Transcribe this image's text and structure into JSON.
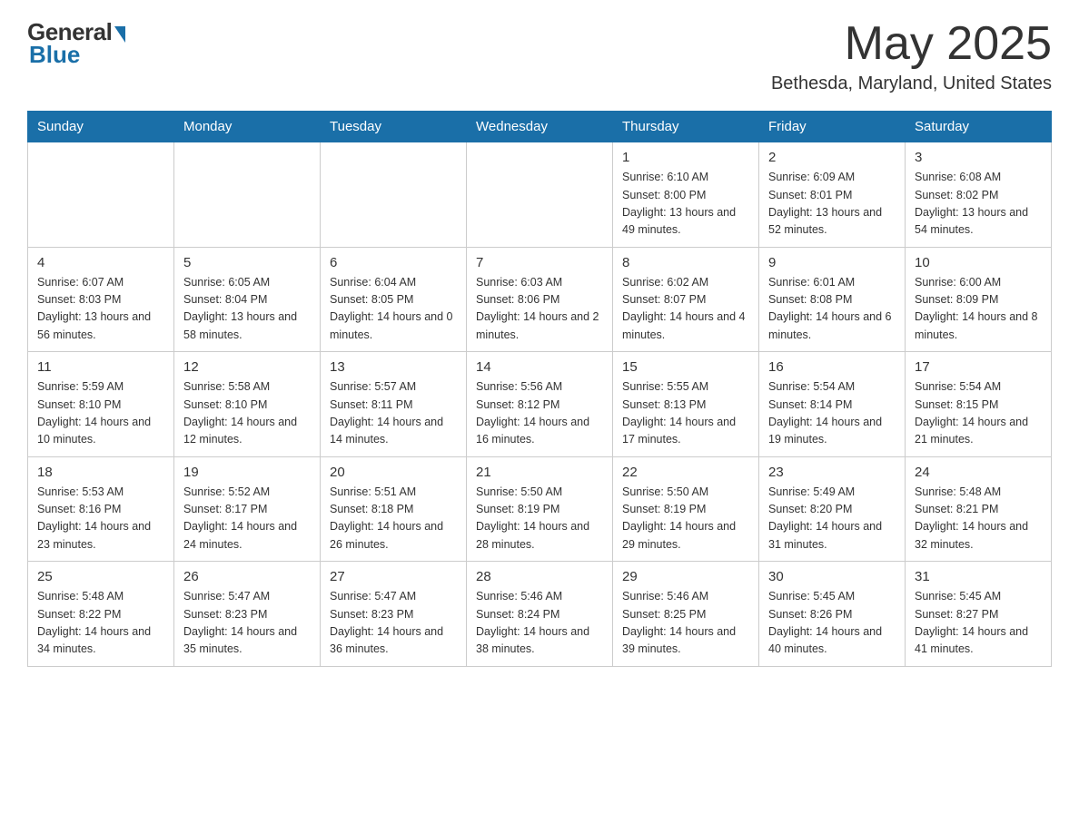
{
  "header": {
    "logo_general": "General",
    "logo_blue": "Blue",
    "main_title": "May 2025",
    "subtitle": "Bethesda, Maryland, United States"
  },
  "days_of_week": [
    "Sunday",
    "Monday",
    "Tuesday",
    "Wednesday",
    "Thursday",
    "Friday",
    "Saturday"
  ],
  "weeks": [
    [
      {
        "day": "",
        "info": ""
      },
      {
        "day": "",
        "info": ""
      },
      {
        "day": "",
        "info": ""
      },
      {
        "day": "",
        "info": ""
      },
      {
        "day": "1",
        "info": "Sunrise: 6:10 AM\nSunset: 8:00 PM\nDaylight: 13 hours and 49 minutes."
      },
      {
        "day": "2",
        "info": "Sunrise: 6:09 AM\nSunset: 8:01 PM\nDaylight: 13 hours and 52 minutes."
      },
      {
        "day": "3",
        "info": "Sunrise: 6:08 AM\nSunset: 8:02 PM\nDaylight: 13 hours and 54 minutes."
      }
    ],
    [
      {
        "day": "4",
        "info": "Sunrise: 6:07 AM\nSunset: 8:03 PM\nDaylight: 13 hours and 56 minutes."
      },
      {
        "day": "5",
        "info": "Sunrise: 6:05 AM\nSunset: 8:04 PM\nDaylight: 13 hours and 58 minutes."
      },
      {
        "day": "6",
        "info": "Sunrise: 6:04 AM\nSunset: 8:05 PM\nDaylight: 14 hours and 0 minutes."
      },
      {
        "day": "7",
        "info": "Sunrise: 6:03 AM\nSunset: 8:06 PM\nDaylight: 14 hours and 2 minutes."
      },
      {
        "day": "8",
        "info": "Sunrise: 6:02 AM\nSunset: 8:07 PM\nDaylight: 14 hours and 4 minutes."
      },
      {
        "day": "9",
        "info": "Sunrise: 6:01 AM\nSunset: 8:08 PM\nDaylight: 14 hours and 6 minutes."
      },
      {
        "day": "10",
        "info": "Sunrise: 6:00 AM\nSunset: 8:09 PM\nDaylight: 14 hours and 8 minutes."
      }
    ],
    [
      {
        "day": "11",
        "info": "Sunrise: 5:59 AM\nSunset: 8:10 PM\nDaylight: 14 hours and 10 minutes."
      },
      {
        "day": "12",
        "info": "Sunrise: 5:58 AM\nSunset: 8:10 PM\nDaylight: 14 hours and 12 minutes."
      },
      {
        "day": "13",
        "info": "Sunrise: 5:57 AM\nSunset: 8:11 PM\nDaylight: 14 hours and 14 minutes."
      },
      {
        "day": "14",
        "info": "Sunrise: 5:56 AM\nSunset: 8:12 PM\nDaylight: 14 hours and 16 minutes."
      },
      {
        "day": "15",
        "info": "Sunrise: 5:55 AM\nSunset: 8:13 PM\nDaylight: 14 hours and 17 minutes."
      },
      {
        "day": "16",
        "info": "Sunrise: 5:54 AM\nSunset: 8:14 PM\nDaylight: 14 hours and 19 minutes."
      },
      {
        "day": "17",
        "info": "Sunrise: 5:54 AM\nSunset: 8:15 PM\nDaylight: 14 hours and 21 minutes."
      }
    ],
    [
      {
        "day": "18",
        "info": "Sunrise: 5:53 AM\nSunset: 8:16 PM\nDaylight: 14 hours and 23 minutes."
      },
      {
        "day": "19",
        "info": "Sunrise: 5:52 AM\nSunset: 8:17 PM\nDaylight: 14 hours and 24 minutes."
      },
      {
        "day": "20",
        "info": "Sunrise: 5:51 AM\nSunset: 8:18 PM\nDaylight: 14 hours and 26 minutes."
      },
      {
        "day": "21",
        "info": "Sunrise: 5:50 AM\nSunset: 8:19 PM\nDaylight: 14 hours and 28 minutes."
      },
      {
        "day": "22",
        "info": "Sunrise: 5:50 AM\nSunset: 8:19 PM\nDaylight: 14 hours and 29 minutes."
      },
      {
        "day": "23",
        "info": "Sunrise: 5:49 AM\nSunset: 8:20 PM\nDaylight: 14 hours and 31 minutes."
      },
      {
        "day": "24",
        "info": "Sunrise: 5:48 AM\nSunset: 8:21 PM\nDaylight: 14 hours and 32 minutes."
      }
    ],
    [
      {
        "day": "25",
        "info": "Sunrise: 5:48 AM\nSunset: 8:22 PM\nDaylight: 14 hours and 34 minutes."
      },
      {
        "day": "26",
        "info": "Sunrise: 5:47 AM\nSunset: 8:23 PM\nDaylight: 14 hours and 35 minutes."
      },
      {
        "day": "27",
        "info": "Sunrise: 5:47 AM\nSunset: 8:23 PM\nDaylight: 14 hours and 36 minutes."
      },
      {
        "day": "28",
        "info": "Sunrise: 5:46 AM\nSunset: 8:24 PM\nDaylight: 14 hours and 38 minutes."
      },
      {
        "day": "29",
        "info": "Sunrise: 5:46 AM\nSunset: 8:25 PM\nDaylight: 14 hours and 39 minutes."
      },
      {
        "day": "30",
        "info": "Sunrise: 5:45 AM\nSunset: 8:26 PM\nDaylight: 14 hours and 40 minutes."
      },
      {
        "day": "31",
        "info": "Sunrise: 5:45 AM\nSunset: 8:27 PM\nDaylight: 14 hours and 41 minutes."
      }
    ]
  ]
}
